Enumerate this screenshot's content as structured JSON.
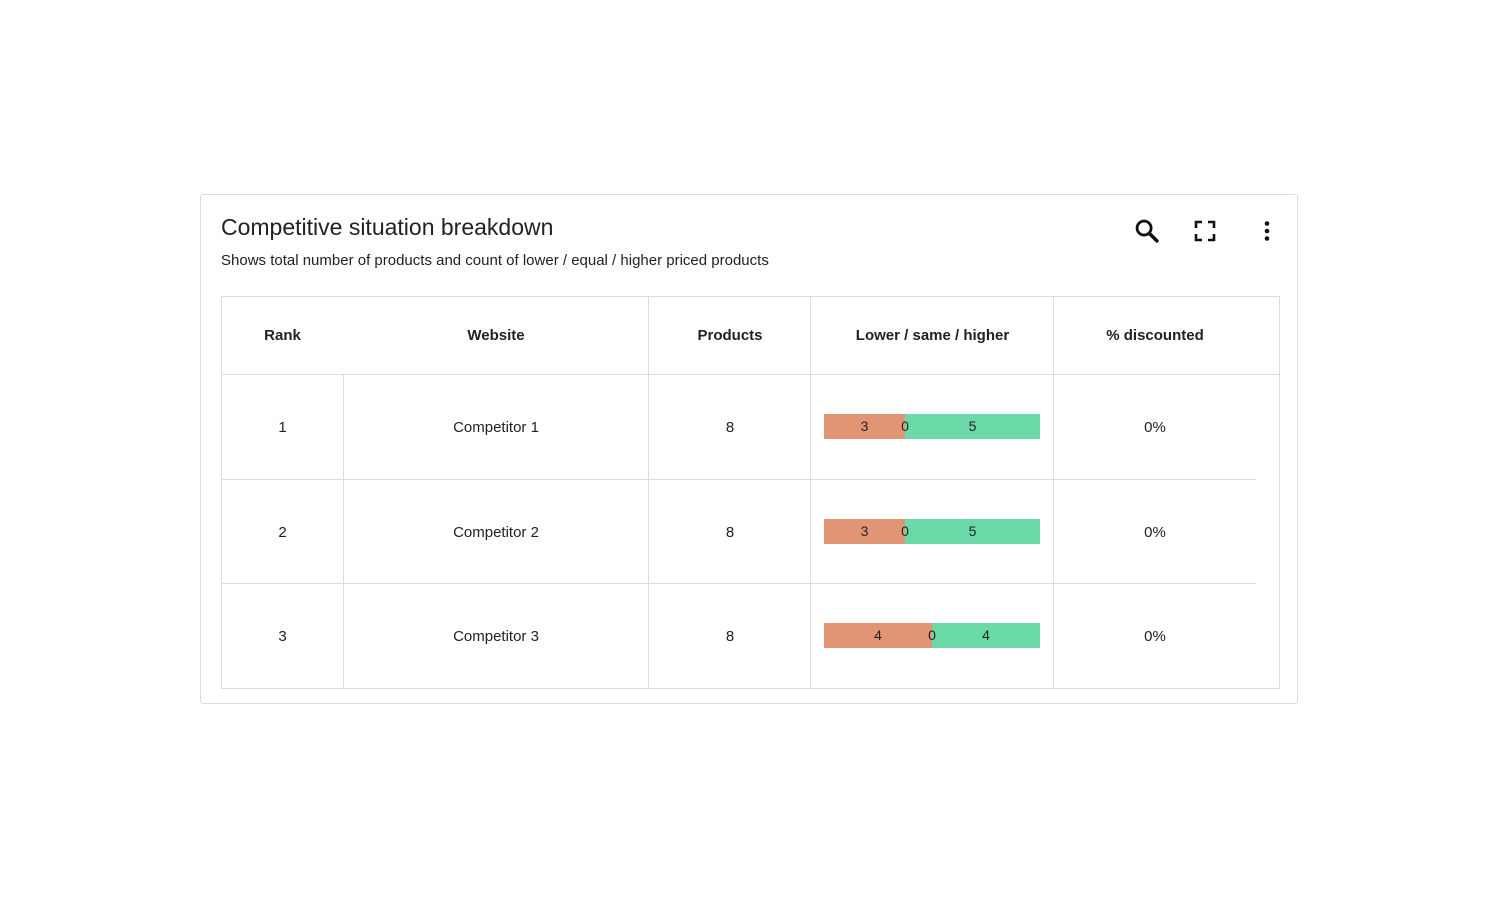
{
  "widget": {
    "title": "Competitive situation breakdown",
    "subtitle": "Shows total number of products and count of lower / equal / higher priced products",
    "icons": [
      "search-icon",
      "fullscreen-icon",
      "more-vert-icon"
    ]
  },
  "table": {
    "headers": [
      "Rank",
      "Website",
      "Products",
      "Lower / same / higher",
      "% discounted"
    ],
    "rows": [
      {
        "rank": "1",
        "website": "Competitor 1",
        "products": "8",
        "lower": 3,
        "same": 0,
        "higher": 5,
        "lower_label": "3",
        "same_label": "0",
        "higher_label": "5",
        "discounted": "0%"
      },
      {
        "rank": "2",
        "website": "Competitor 2",
        "products": "8",
        "lower": 3,
        "same": 0,
        "higher": 5,
        "lower_label": "3",
        "same_label": "0",
        "higher_label": "5",
        "discounted": "0%"
      },
      {
        "rank": "3",
        "website": "Competitor 3",
        "products": "8",
        "lower": 4,
        "same": 0,
        "higher": 4,
        "lower_label": "4",
        "same_label": "0",
        "higher_label": "4",
        "discounted": "0%"
      }
    ]
  },
  "colors": {
    "lower": "#e29575",
    "same": "#b7b7b7",
    "higher": "#6bdaa8",
    "border": "#dcdcdc"
  }
}
